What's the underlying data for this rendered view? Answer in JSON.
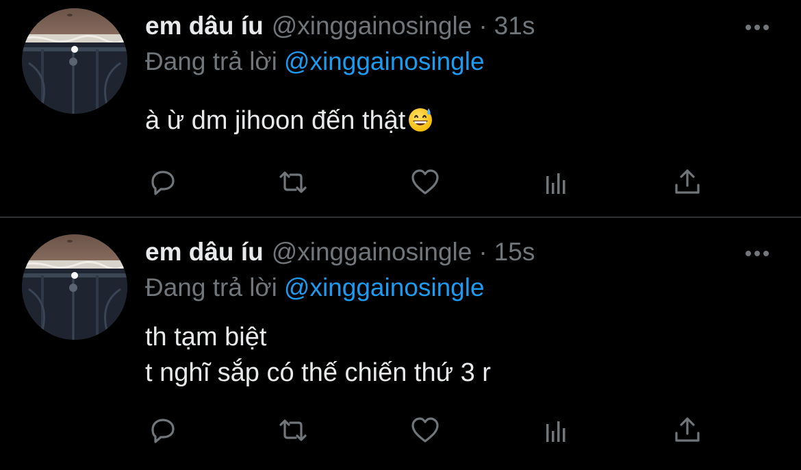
{
  "colors": {
    "background": "#000000",
    "text_primary": "#e7e9ea",
    "text_secondary": "#71767b",
    "link": "#1d9bf0",
    "divider": "#2f3336"
  },
  "tweets": [
    {
      "display_name": "em dâu íu",
      "handle": "@xinggainosingle",
      "separator": "·",
      "time": "31s",
      "reply_label": "Đang trả lời",
      "reply_to": "@xinggainosingle",
      "text": "à ừ dm jihoon đến thật",
      "emoji": "grinning-face-with-sweat-icon"
    },
    {
      "display_name": "em dâu íu",
      "handle": "@xinggainosingle",
      "separator": "·",
      "time": "15s",
      "reply_label": "Đang trả lời",
      "reply_to": "@xinggainosingle",
      "text": "th tạm biệt\nt nghĩ sắp có thế chiến thứ 3 r"
    }
  ],
  "icons": {
    "reply": "reply-icon",
    "retweet": "retweet-icon",
    "like": "heart-icon",
    "views": "views-icon",
    "share": "share-icon",
    "more": "more-icon"
  }
}
